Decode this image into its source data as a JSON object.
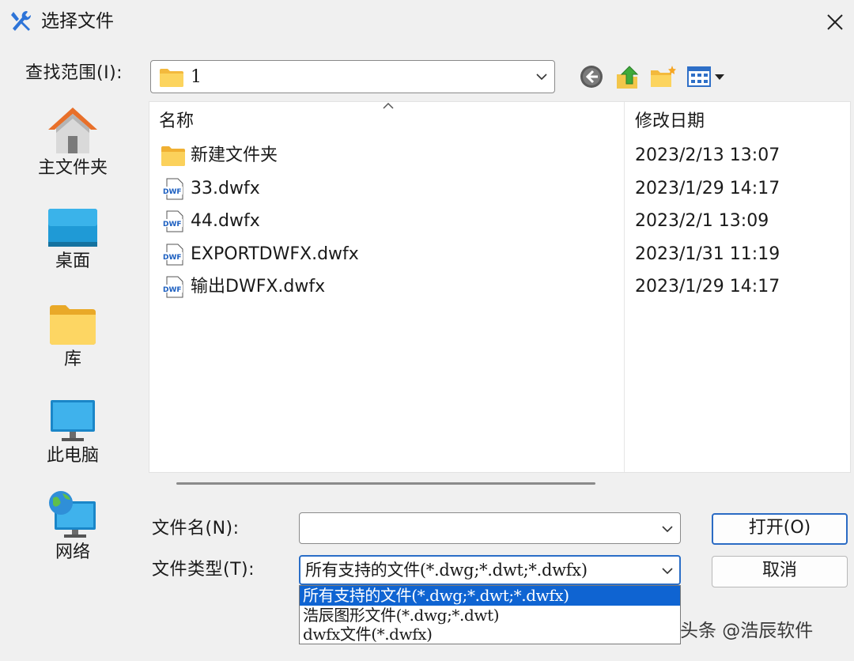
{
  "window": {
    "title": "选择文件",
    "close_label": "×"
  },
  "lookin": {
    "label": "查找范围(I):",
    "value": "1"
  },
  "places": [
    {
      "label": "主文件夹",
      "icon": "home-icon"
    },
    {
      "label": "桌面",
      "icon": "desktop-icon"
    },
    {
      "label": "库",
      "icon": "library-folder-icon"
    },
    {
      "label": "此电脑",
      "icon": "computer-icon"
    },
    {
      "label": "网络",
      "icon": "network-icon"
    }
  ],
  "filelist": {
    "columns": {
      "name": "名称",
      "date": "修改日期"
    },
    "rows": [
      {
        "name": "新建文件夹",
        "date": "2023/2/13 13:07",
        "type": "folder"
      },
      {
        "name": "33.dwfx",
        "date": "2023/1/29 14:17",
        "type": "dwfx"
      },
      {
        "name": "44.dwfx",
        "date": "2023/2/1 13:09",
        "type": "dwfx"
      },
      {
        "name": "EXPORTDWFX.dwfx",
        "date": "2023/1/31 11:19",
        "type": "dwfx"
      },
      {
        "name": "输出DWFX.dwfx",
        "date": "2023/1/29 14:17",
        "type": "dwfx"
      }
    ]
  },
  "filename": {
    "label": "文件名(N):",
    "value": ""
  },
  "filetype": {
    "label": "文件类型(T):",
    "selected": "所有支持的文件(*.dwg;*.dwt;*.dwfx)",
    "options": [
      "所有支持的文件(*.dwg;*.dwt;*.dwfx)",
      "浩辰图形文件(*.dwg;*.dwt)",
      "dwfx文件(*.dwfx)"
    ]
  },
  "buttons": {
    "open": "打开(O)",
    "cancel": "取消"
  },
  "watermark": "头条 @浩辰软件",
  "colors": {
    "accent": "#0f64d2",
    "folder": "#f5c542",
    "background": "#f0f0f0"
  }
}
